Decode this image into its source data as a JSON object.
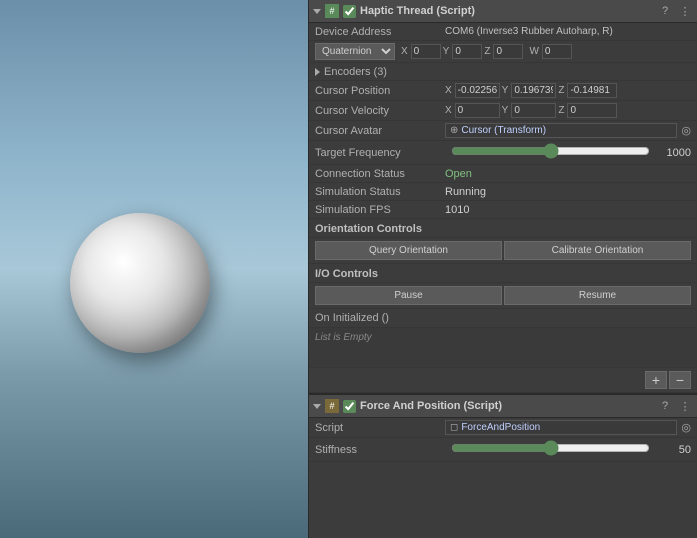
{
  "viewport": {
    "background": "gradient"
  },
  "inspector": {
    "script1": {
      "title": "Haptic Thread (Script)",
      "deviceAddress": {
        "label": "Device Address",
        "value": "COM6 (Inverse3 Rubber Autoharp, R)"
      },
      "quaternion": {
        "label": "Quaternion",
        "x": "0",
        "y": "0",
        "z": "0",
        "w": "0"
      },
      "encoders": {
        "label": "Encoders (3)"
      },
      "cursorPosition": {
        "label": "Cursor Position",
        "x": "-0.02256",
        "y": "0.196739",
        "z": "-0.14981"
      },
      "cursorVelocity": {
        "label": "Cursor Velocity",
        "x": "0",
        "y": "0",
        "z": "0"
      },
      "cursorAvatar": {
        "label": "Cursor Avatar",
        "icon": "⊕",
        "value": "Cursor (Transform)"
      },
      "targetFrequency": {
        "label": "Target Frequency",
        "value": "1000",
        "sliderMin": 0,
        "sliderMax": 2000,
        "sliderVal": 1000
      },
      "connectionStatus": {
        "label": "Connection Status",
        "value": "Open"
      },
      "simulationStatus": {
        "label": "Simulation Status",
        "value": "Running"
      },
      "simulationFPS": {
        "label": "Simulation FPS",
        "value": "1010"
      },
      "orientationControls": {
        "label": "Orientation Controls",
        "queryBtn": "Query Orientation",
        "calibrateBtn": "Calibrate Orientation"
      },
      "ioControls": {
        "label": "I/O Controls",
        "pauseBtn": "Pause",
        "resumeBtn": "Resume"
      },
      "onInitialized": {
        "label": "On Initialized ()"
      },
      "listEmpty": {
        "label": "List is Empty"
      },
      "addBtn": "+",
      "removeBtn": "−"
    },
    "script2": {
      "title": "Force And Position (Script)",
      "scriptField": {
        "label": "Script",
        "value": "ForceAndPosition"
      },
      "stiffness": {
        "label": "Stiffness",
        "value": "50",
        "sliderMin": 0,
        "sliderMax": 100,
        "sliderVal": 50
      }
    }
  }
}
